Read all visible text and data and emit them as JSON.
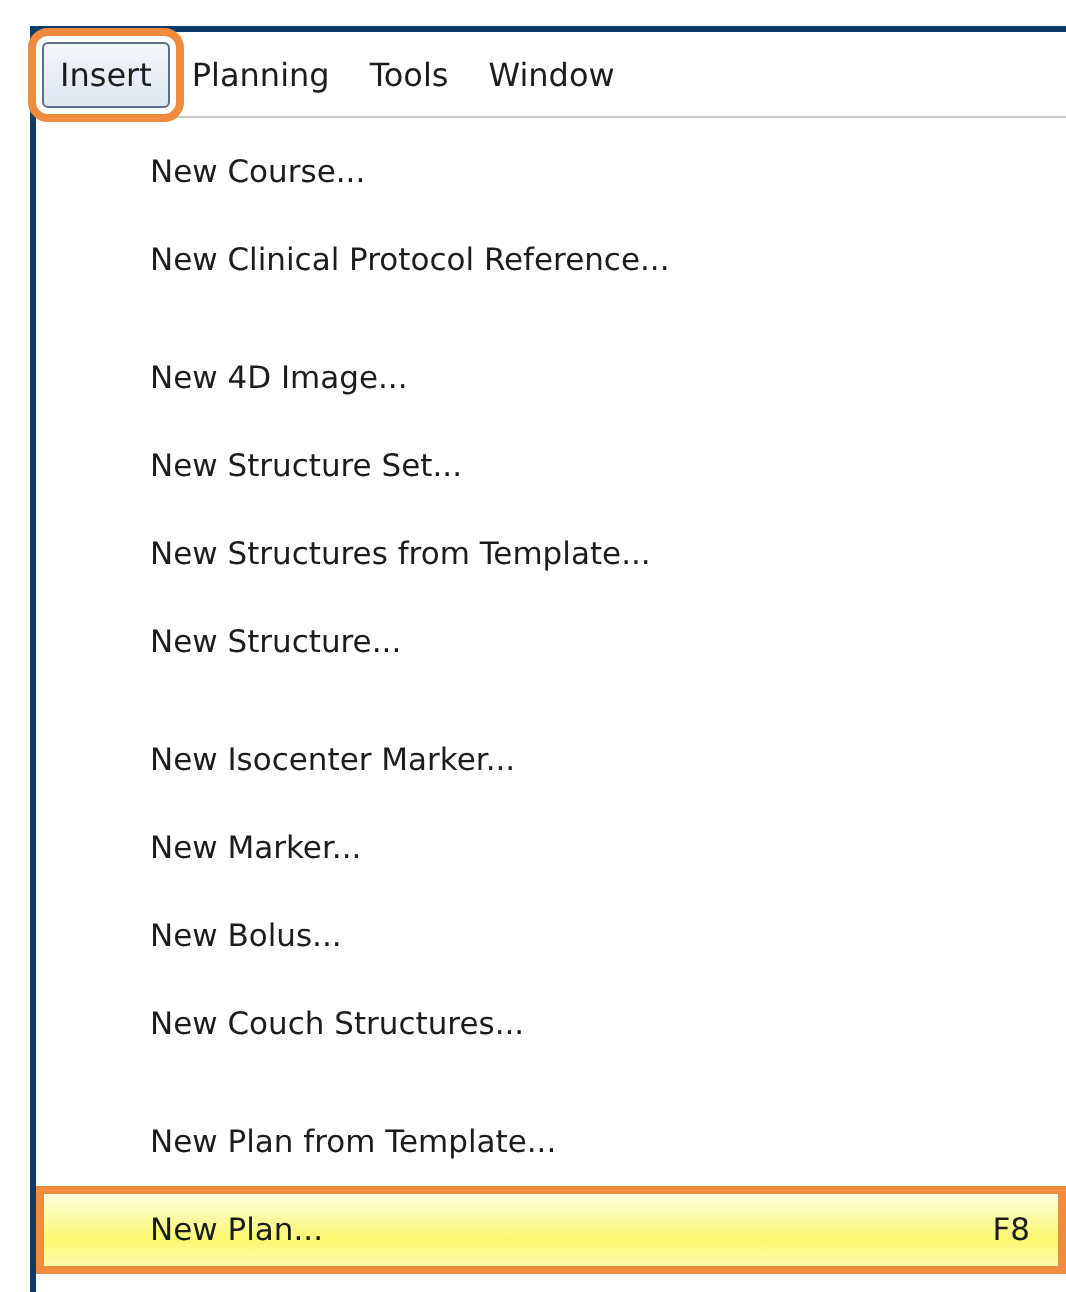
{
  "menu_bar": [
    {
      "label": "Insert",
      "selected": true,
      "highlighted": true
    },
    {
      "label": "Planning",
      "selected": false,
      "highlighted": false
    },
    {
      "label": "Tools",
      "selected": false,
      "highlighted": false
    },
    {
      "label": "Window",
      "selected": false,
      "highlighted": false
    }
  ],
  "menu": {
    "groups": [
      {
        "items": [
          {
            "label": "New Course...",
            "hovered": false,
            "highlighted": false
          },
          {
            "label": "New Clinical Protocol Reference...",
            "hovered": false,
            "highlighted": false
          }
        ]
      },
      {
        "items": [
          {
            "label": "New 4D Image...",
            "hovered": false,
            "highlighted": false
          },
          {
            "label": "New Structure Set...",
            "hovered": false,
            "highlighted": false
          },
          {
            "label": "New Structures from Template...",
            "hovered": false,
            "highlighted": false
          },
          {
            "label": "New Structure...",
            "hovered": false,
            "highlighted": false
          }
        ]
      },
      {
        "items": [
          {
            "label": "New Isocenter Marker...",
            "hovered": false,
            "highlighted": false
          },
          {
            "label": "New Marker...",
            "hovered": false,
            "highlighted": false
          },
          {
            "label": "New Bolus...",
            "hovered": false,
            "highlighted": false
          },
          {
            "label": "New Couch Structures...",
            "hovered": false,
            "highlighted": false
          }
        ]
      },
      {
        "items": [
          {
            "label": "New Plan from Template...",
            "hovered": false,
            "highlighted": false
          },
          {
            "label": "New Plan...",
            "shortcut": "F8",
            "hovered": true,
            "highlighted": true
          }
        ]
      }
    ]
  }
}
